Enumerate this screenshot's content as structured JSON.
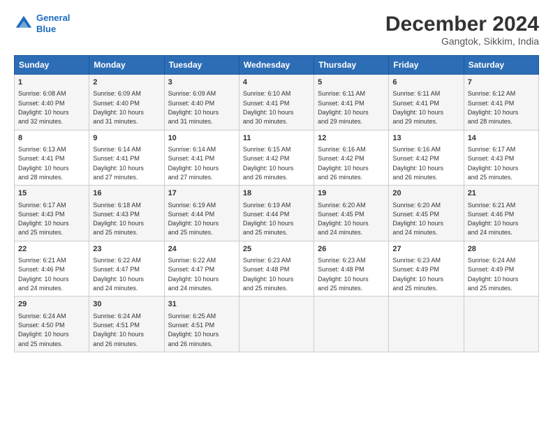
{
  "logo": {
    "line1": "General",
    "line2": "Blue"
  },
  "title": "December 2024",
  "location": "Gangtok, Sikkim, India",
  "headers": [
    "Sunday",
    "Monday",
    "Tuesday",
    "Wednesday",
    "Thursday",
    "Friday",
    "Saturday"
  ],
  "weeks": [
    [
      {
        "day": "1",
        "info": "Sunrise: 6:08 AM\nSunset: 4:40 PM\nDaylight: 10 hours\nand 32 minutes."
      },
      {
        "day": "2",
        "info": "Sunrise: 6:09 AM\nSunset: 4:40 PM\nDaylight: 10 hours\nand 31 minutes."
      },
      {
        "day": "3",
        "info": "Sunrise: 6:09 AM\nSunset: 4:40 PM\nDaylight: 10 hours\nand 31 minutes."
      },
      {
        "day": "4",
        "info": "Sunrise: 6:10 AM\nSunset: 4:41 PM\nDaylight: 10 hours\nand 30 minutes."
      },
      {
        "day": "5",
        "info": "Sunrise: 6:11 AM\nSunset: 4:41 PM\nDaylight: 10 hours\nand 29 minutes."
      },
      {
        "day": "6",
        "info": "Sunrise: 6:11 AM\nSunset: 4:41 PM\nDaylight: 10 hours\nand 29 minutes."
      },
      {
        "day": "7",
        "info": "Sunrise: 6:12 AM\nSunset: 4:41 PM\nDaylight: 10 hours\nand 28 minutes."
      }
    ],
    [
      {
        "day": "8",
        "info": "Sunrise: 6:13 AM\nSunset: 4:41 PM\nDaylight: 10 hours\nand 28 minutes."
      },
      {
        "day": "9",
        "info": "Sunrise: 6:14 AM\nSunset: 4:41 PM\nDaylight: 10 hours\nand 27 minutes."
      },
      {
        "day": "10",
        "info": "Sunrise: 6:14 AM\nSunset: 4:41 PM\nDaylight: 10 hours\nand 27 minutes."
      },
      {
        "day": "11",
        "info": "Sunrise: 6:15 AM\nSunset: 4:42 PM\nDaylight: 10 hours\nand 26 minutes."
      },
      {
        "day": "12",
        "info": "Sunrise: 6:16 AM\nSunset: 4:42 PM\nDaylight: 10 hours\nand 26 minutes."
      },
      {
        "day": "13",
        "info": "Sunrise: 6:16 AM\nSunset: 4:42 PM\nDaylight: 10 hours\nand 26 minutes."
      },
      {
        "day": "14",
        "info": "Sunrise: 6:17 AM\nSunset: 4:43 PM\nDaylight: 10 hours\nand 25 minutes."
      }
    ],
    [
      {
        "day": "15",
        "info": "Sunrise: 6:17 AM\nSunset: 4:43 PM\nDaylight: 10 hours\nand 25 minutes."
      },
      {
        "day": "16",
        "info": "Sunrise: 6:18 AM\nSunset: 4:43 PM\nDaylight: 10 hours\nand 25 minutes."
      },
      {
        "day": "17",
        "info": "Sunrise: 6:19 AM\nSunset: 4:44 PM\nDaylight: 10 hours\nand 25 minutes."
      },
      {
        "day": "18",
        "info": "Sunrise: 6:19 AM\nSunset: 4:44 PM\nDaylight: 10 hours\nand 25 minutes."
      },
      {
        "day": "19",
        "info": "Sunrise: 6:20 AM\nSunset: 4:45 PM\nDaylight: 10 hours\nand 24 minutes."
      },
      {
        "day": "20",
        "info": "Sunrise: 6:20 AM\nSunset: 4:45 PM\nDaylight: 10 hours\nand 24 minutes."
      },
      {
        "day": "21",
        "info": "Sunrise: 6:21 AM\nSunset: 4:46 PM\nDaylight: 10 hours\nand 24 minutes."
      }
    ],
    [
      {
        "day": "22",
        "info": "Sunrise: 6:21 AM\nSunset: 4:46 PM\nDaylight: 10 hours\nand 24 minutes."
      },
      {
        "day": "23",
        "info": "Sunrise: 6:22 AM\nSunset: 4:47 PM\nDaylight: 10 hours\nand 24 minutes."
      },
      {
        "day": "24",
        "info": "Sunrise: 6:22 AM\nSunset: 4:47 PM\nDaylight: 10 hours\nand 24 minutes."
      },
      {
        "day": "25",
        "info": "Sunrise: 6:23 AM\nSunset: 4:48 PM\nDaylight: 10 hours\nand 25 minutes."
      },
      {
        "day": "26",
        "info": "Sunrise: 6:23 AM\nSunset: 4:48 PM\nDaylight: 10 hours\nand 25 minutes."
      },
      {
        "day": "27",
        "info": "Sunrise: 6:23 AM\nSunset: 4:49 PM\nDaylight: 10 hours\nand 25 minutes."
      },
      {
        "day": "28",
        "info": "Sunrise: 6:24 AM\nSunset: 4:49 PM\nDaylight: 10 hours\nand 25 minutes."
      }
    ],
    [
      {
        "day": "29",
        "info": "Sunrise: 6:24 AM\nSunset: 4:50 PM\nDaylight: 10 hours\nand 25 minutes."
      },
      {
        "day": "30",
        "info": "Sunrise: 6:24 AM\nSunset: 4:51 PM\nDaylight: 10 hours\nand 26 minutes."
      },
      {
        "day": "31",
        "info": "Sunrise: 6:25 AM\nSunset: 4:51 PM\nDaylight: 10 hours\nand 26 minutes."
      },
      null,
      null,
      null,
      null
    ]
  ]
}
